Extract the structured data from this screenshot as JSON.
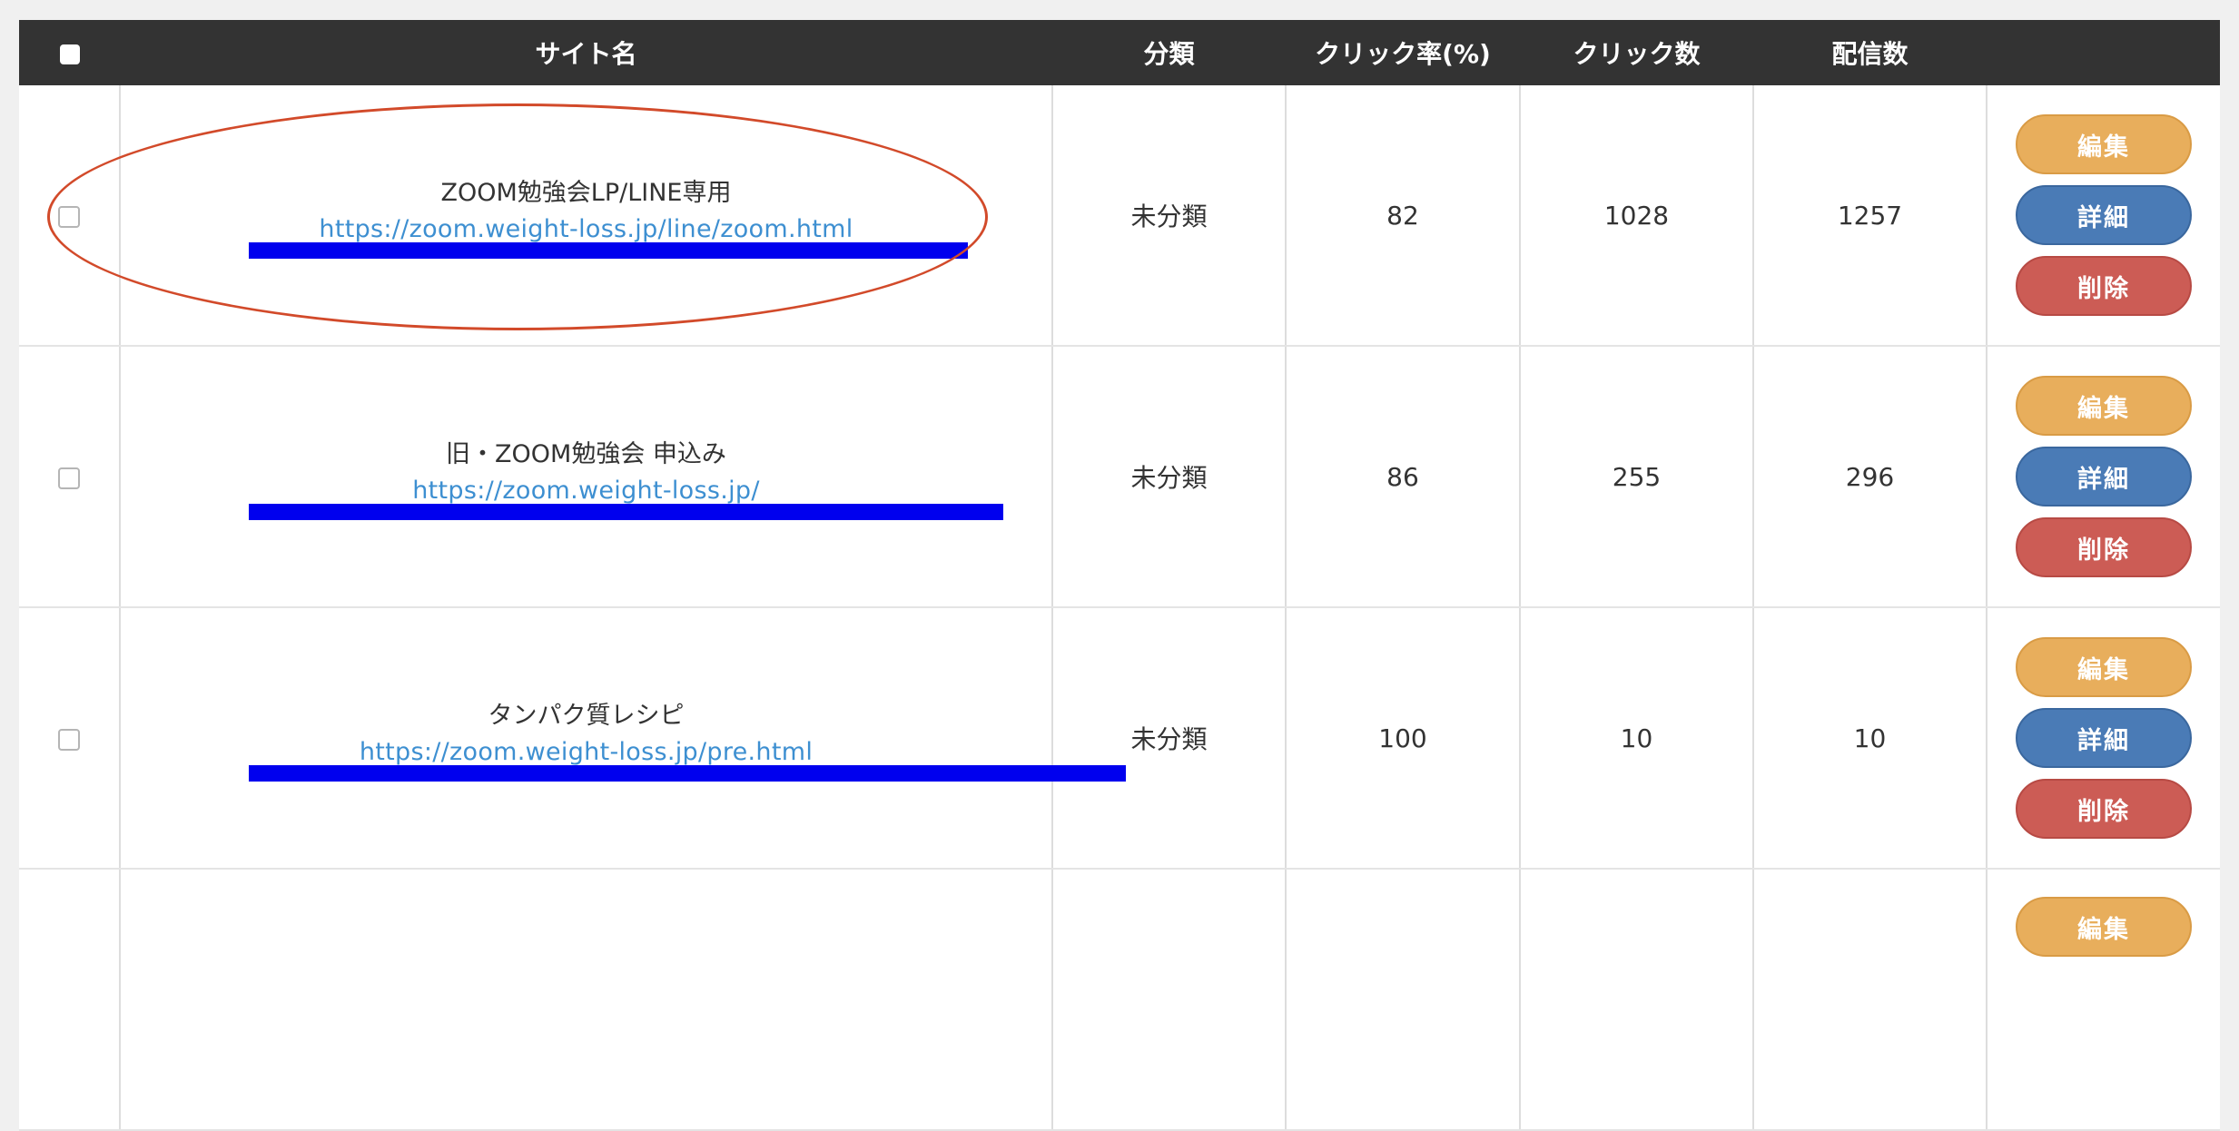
{
  "table": {
    "headers": {
      "site_name": "サイト名",
      "category": "分類",
      "click_rate": "クリック率(%)",
      "clicks": "クリック数",
      "deliveries": "配信数"
    },
    "buttons": {
      "edit": "編集",
      "detail": "詳細",
      "delete": "削除"
    },
    "rows": [
      {
        "name": "ZOOM勉強会LP/LINE専用",
        "url": "https://zoom.weight-loss.jp/line/zoom.html",
        "category": "未分類",
        "click_rate": "82",
        "clicks": "1028",
        "deliveries": "1257"
      },
      {
        "name": "旧・ZOOM勉強会 申込み",
        "url": "https://zoom.weight-loss.jp/",
        "category": "未分類",
        "click_rate": "86",
        "clicks": "255",
        "deliveries": "296"
      },
      {
        "name": "タンパク質レシピ",
        "url": "https://zoom.weight-loss.jp/pre.html",
        "category": "未分類",
        "click_rate": "100",
        "clicks": "10",
        "deliveries": "10"
      }
    ]
  },
  "colors": {
    "header_bg": "#333333",
    "link": "#3d8fd1",
    "edit": "#e8ae5c",
    "detail": "#4a7bb6",
    "delete": "#cc5c55",
    "redaction": "#0000ee",
    "annotation": "#d24a2a"
  }
}
